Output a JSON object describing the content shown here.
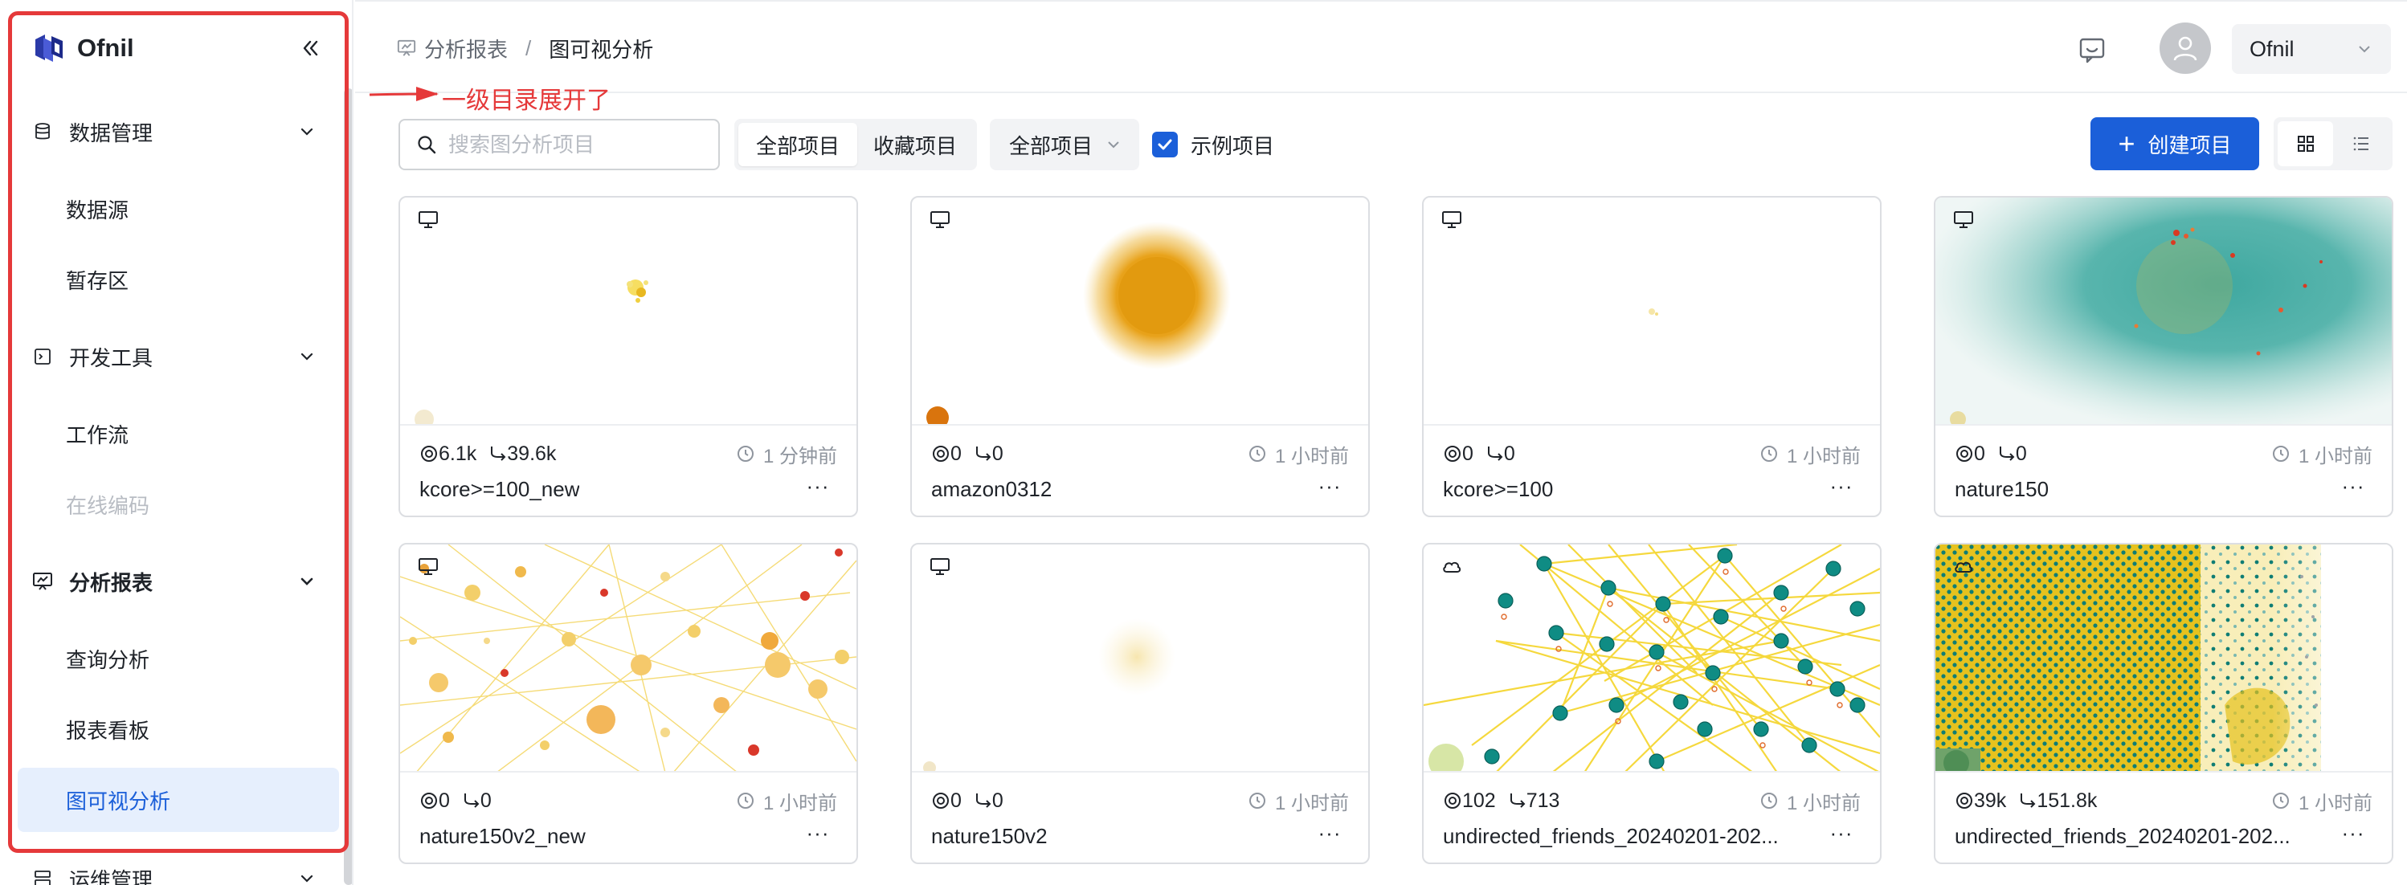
{
  "brand": {
    "name": "Ofnil"
  },
  "sidebar": {
    "groups": [
      {
        "label": "数据管理",
        "items": [
          "数据源",
          "暂存区"
        ]
      },
      {
        "label": "开发工具",
        "items": [
          "工作流",
          "在线编码"
        ]
      },
      {
        "label": "分析报表",
        "items": [
          "查询分析",
          "报表看板",
          "图可视分析"
        ]
      },
      {
        "label": "运维管理"
      }
    ]
  },
  "header": {
    "breadcrumb": {
      "parent": "分析报表",
      "separator": "/",
      "current": "图可视分析"
    },
    "user": "Ofnil"
  },
  "annotation": {
    "text": "一级目录展开了",
    "color": "#e5393a"
  },
  "toolbar": {
    "search_placeholder": "搜索图分析项目",
    "segment": [
      "全部项目",
      "收藏项目"
    ],
    "filter": "全部项目",
    "example_label": "示例项目",
    "example_checked": true,
    "create_label": "创建项目"
  },
  "colors": {
    "accent": "#1b5fd9",
    "selected_bg": "#e6effd"
  },
  "cards": [
    {
      "icon": "monitor-icon",
      "nodes": "6.1k",
      "edges": "39.6k",
      "time": "1 分钟前",
      "name": "kcore>=100_new"
    },
    {
      "icon": "monitor-icon",
      "nodes": "0",
      "edges": "0",
      "time": "1 小时前",
      "name": "amazon0312"
    },
    {
      "icon": "monitor-icon",
      "nodes": "0",
      "edges": "0",
      "time": "1 小时前",
      "name": "kcore>=100"
    },
    {
      "icon": "monitor-icon",
      "nodes": "0",
      "edges": "0",
      "time": "1 小时前",
      "name": "nature150"
    },
    {
      "icon": "monitor-icon",
      "nodes": "0",
      "edges": "0",
      "time": "1 小时前",
      "name": "nature150v2_new"
    },
    {
      "icon": "monitor-icon",
      "nodes": "0",
      "edges": "0",
      "time": "1 小时前",
      "name": "nature150v2"
    },
    {
      "icon": "cloud-icon",
      "nodes": "102",
      "edges": "713",
      "time": "1 小时前",
      "name": "undirected_friends_20240201-202..."
    },
    {
      "icon": "cloud-icon",
      "nodes": "39k",
      "edges": "151.8k",
      "time": "1 小时前",
      "name": "undirected_friends_20240201-202..."
    }
  ]
}
